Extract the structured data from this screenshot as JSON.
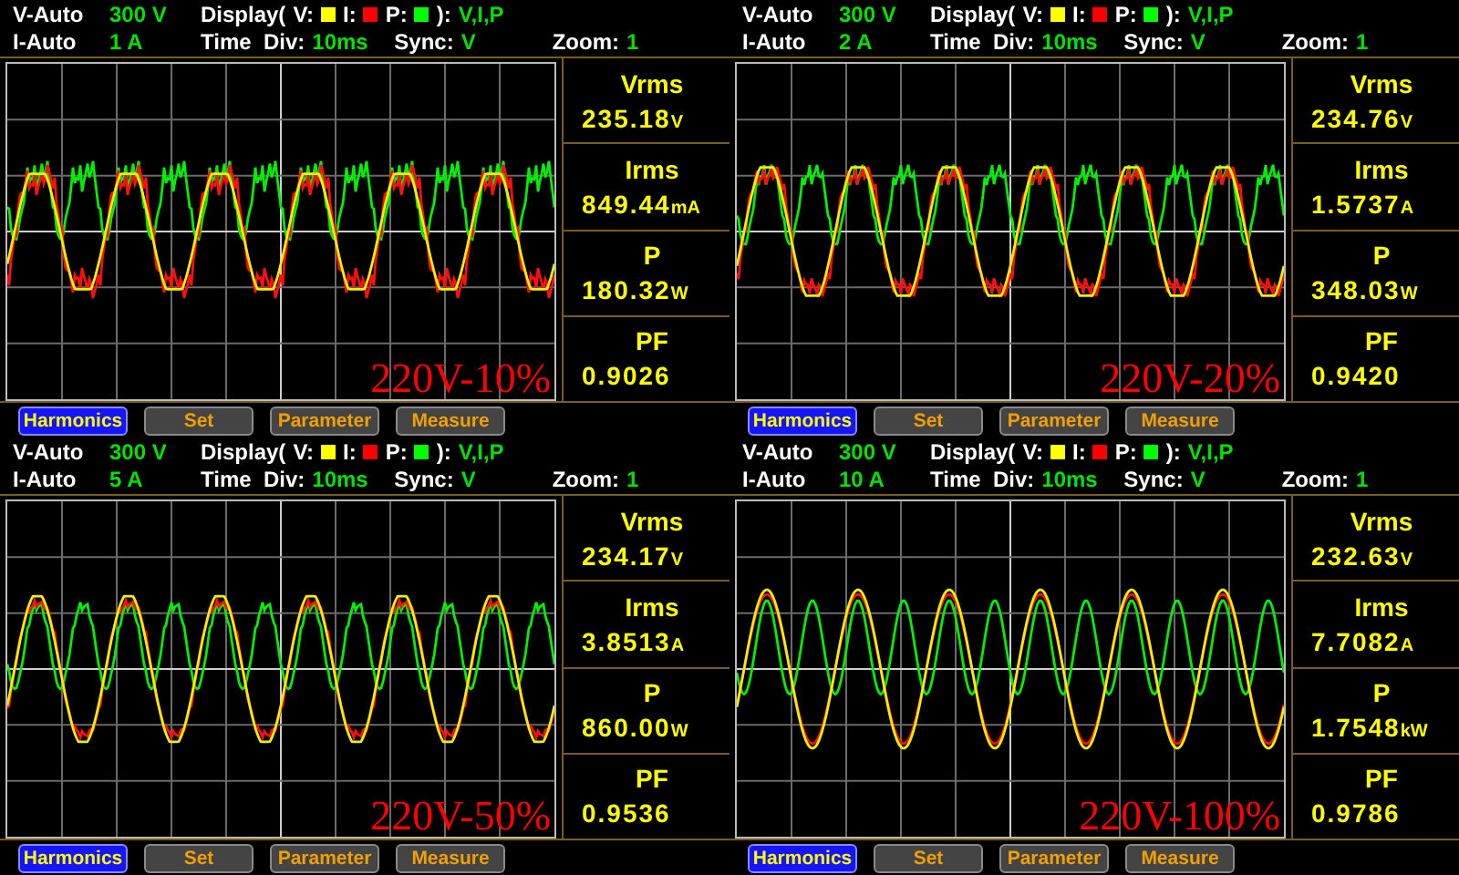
{
  "panels": [
    {
      "v_label": "V-Auto",
      "v_range": "300 V",
      "i_label": "I-Auto",
      "i_range": "1 A",
      "display": {
        "label": "Display(",
        "channels": [
          {
            "name": "V:",
            "color": "#ffff00"
          },
          {
            "name": "I:",
            "color": "#ff0000"
          },
          {
            "name": "P:",
            "color": "#00ff00"
          }
        ],
        "close": "):",
        "value": "V,I,P"
      },
      "time_label": "Time  Div:",
      "time_div": "10ms",
      "sync_label": "Sync:",
      "sync": "V",
      "zoom_label": "Zoom:",
      "zoom": "1",
      "caption": "220V-10%",
      "readings": [
        {
          "label": "Vrms",
          "value": "235.18",
          "unit": "V"
        },
        {
          "label": "Irms",
          "value": "849.44",
          "unit": "mA"
        },
        {
          "label": "P",
          "value": "180.32",
          "unit": "W"
        },
        {
          "label": "PF",
          "value": "0.9026"
        }
      ],
      "buttons": [
        {
          "label": "Harmonics",
          "selected": true
        },
        {
          "label": "Set",
          "selected": false
        },
        {
          "label": "Parameter",
          "selected": false
        },
        {
          "label": "Measure",
          "selected": false
        }
      ]
    },
    {
      "v_label": "V-Auto",
      "v_range": "300 V",
      "i_label": "I-Auto",
      "i_range": "2 A",
      "display": {
        "label": "Display(",
        "channels": [
          {
            "name": "V:",
            "color": "#ffff00"
          },
          {
            "name": "I:",
            "color": "#ff0000"
          },
          {
            "name": "P:",
            "color": "#00ff00"
          }
        ],
        "close": "):",
        "value": "V,I,P"
      },
      "time_label": "Time  Div:",
      "time_div": "10ms",
      "sync_label": "Sync:",
      "sync": "V",
      "zoom_label": "Zoom:",
      "zoom": "1",
      "caption": "220V-20%",
      "readings": [
        {
          "label": "Vrms",
          "value": "234.76",
          "unit": "V"
        },
        {
          "label": "Irms",
          "value": "1.5737",
          "unit": "A"
        },
        {
          "label": "P",
          "value": "348.03",
          "unit": "W"
        },
        {
          "label": "PF",
          "value": "0.9420"
        }
      ],
      "buttons": [
        {
          "label": "Harmonics",
          "selected": true
        },
        {
          "label": "Set",
          "selected": false
        },
        {
          "label": "Parameter",
          "selected": false
        },
        {
          "label": "Measure",
          "selected": false
        }
      ]
    },
    {
      "v_label": "V-Auto",
      "v_range": "300 V",
      "i_label": "I-Auto",
      "i_range": "5 A",
      "display": {
        "label": "Display(",
        "channels": [
          {
            "name": "V:",
            "color": "#ffff00"
          },
          {
            "name": "I:",
            "color": "#ff0000"
          },
          {
            "name": "P:",
            "color": "#00ff00"
          }
        ],
        "close": "):",
        "value": "V,I,P"
      },
      "time_label": "Time  Div:",
      "time_div": "10ms",
      "sync_label": "Sync:",
      "sync": "V",
      "zoom_label": "Zoom:",
      "zoom": "1",
      "caption": "220V-50%",
      "readings": [
        {
          "label": "Vrms",
          "value": "234.17",
          "unit": "V"
        },
        {
          "label": "Irms",
          "value": "3.8513",
          "unit": "A"
        },
        {
          "label": "P",
          "value": "860.00",
          "unit": "W"
        },
        {
          "label": "PF",
          "value": "0.9536"
        }
      ],
      "buttons": [
        {
          "label": "Harmonics",
          "selected": true
        },
        {
          "label": "Set",
          "selected": false
        },
        {
          "label": "Parameter",
          "selected": false
        },
        {
          "label": "Measure",
          "selected": false
        }
      ]
    },
    {
      "v_label": "V-Auto",
      "v_range": "300 V",
      "i_label": "I-Auto",
      "i_range": "10 A",
      "display": {
        "label": "Display(",
        "channels": [
          {
            "name": "V:",
            "color": "#ffff00"
          },
          {
            "name": "I:",
            "color": "#ff0000"
          },
          {
            "name": "P:",
            "color": "#00ff00"
          }
        ],
        "close": "):",
        "value": "V,I,P"
      },
      "time_label": "Time  Div:",
      "time_div": "10ms",
      "sync_label": "Sync:",
      "sync": "V",
      "zoom_label": "Zoom:",
      "zoom": "1",
      "caption": "220V-100%",
      "readings": [
        {
          "label": "Vrms",
          "value": "232.63",
          "unit": "V"
        },
        {
          "label": "Irms",
          "value": "7.7082",
          "unit": "A"
        },
        {
          "label": "P",
          "value": "1.7548",
          "unit": "kW"
        },
        {
          "label": "PF",
          "value": "0.9786"
        }
      ],
      "buttons": [
        {
          "label": "Harmonics",
          "selected": true
        },
        {
          "label": "Set",
          "selected": false
        },
        {
          "label": "Parameter",
          "selected": false
        },
        {
          "label": "Measure",
          "selected": false
        }
      ]
    }
  ]
}
